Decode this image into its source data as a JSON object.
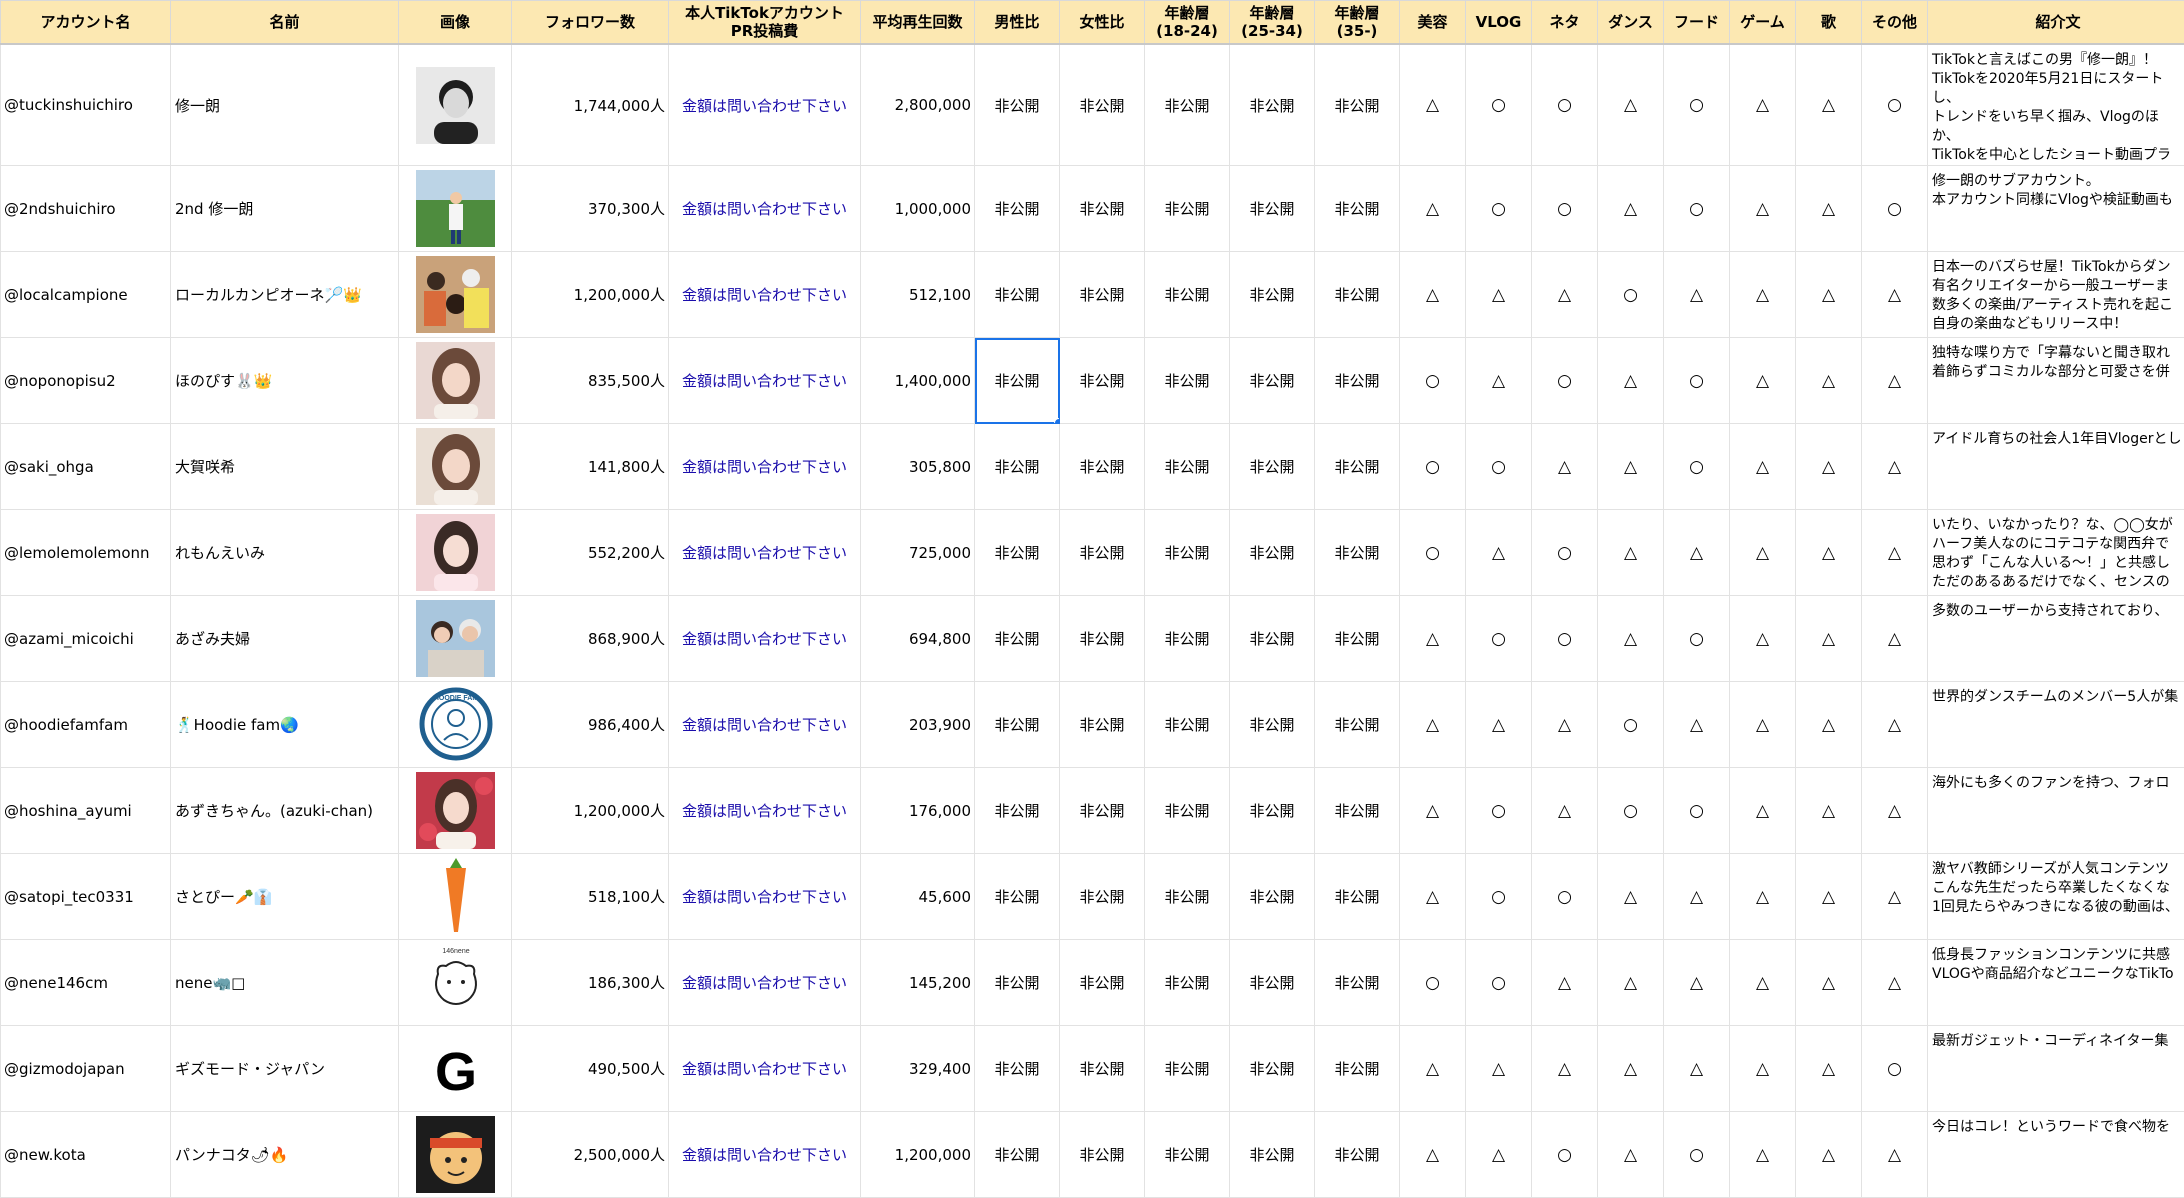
{
  "headers": [
    {
      "l1": "アカウント名"
    },
    {
      "l1": "名前"
    },
    {
      "l1": "画像"
    },
    {
      "l1": "フォロワー数"
    },
    {
      "l1": "本人TikTokアカウント",
      "l2": "PR投稿費"
    },
    {
      "l1": "平均再生回数"
    },
    {
      "l1": "男性比"
    },
    {
      "l1": "女性比"
    },
    {
      "l1": "年齢層",
      "l2": "(18-24)"
    },
    {
      "l1": "年齢層",
      "l2": "(25-34)"
    },
    {
      "l1": "年齢層",
      "l2": "(35-)"
    },
    {
      "l1": "美容"
    },
    {
      "l1": "VLOG"
    },
    {
      "l1": "ネタ"
    },
    {
      "l1": "ダンス"
    },
    {
      "l1": "フード"
    },
    {
      "l1": "ゲーム"
    },
    {
      "l1": "歌"
    },
    {
      "l1": "その他"
    },
    {
      "l1": "紹介文"
    }
  ],
  "rows": [
    {
      "account": "@tuckinshuichiro",
      "name": "修一朗",
      "image": "portrait-bw",
      "followers": "1,744,000人",
      "pr": "金額は問い合わせ下さい",
      "avg_views": "2,800,000",
      "male": "非公開",
      "female": "非公開",
      "age1": "非公開",
      "age2": "非公開",
      "age3": "非公開",
      "tags": [
        "△",
        "○",
        "○",
        "△",
        "○",
        "△",
        "△",
        "○"
      ],
      "intro": "TikTokと言えばこの男『修一朗』！\nTikTokを2020年5月21日にスタートし、\nトレンドをいち早く掴み、Vlogのほか、\nTikTokを中心としたショート動画プラ"
    },
    {
      "account": "@2ndshuichiro",
      "name": "2nd 修一朗",
      "image": "baseball-field",
      "followers": "370,300人",
      "pr": "金額は問い合わせ下さい",
      "avg_views": "1,000,000",
      "male": "非公開",
      "female": "非公開",
      "age1": "非公開",
      "age2": "非公開",
      "age3": "非公開",
      "tags": [
        "△",
        "○",
        "○",
        "△",
        "○",
        "△",
        "△",
        "○"
      ],
      "intro": "修一朗のサブアカウント。\n本アカウント同様にVlogや検証動画も"
    },
    {
      "account": "@localcampione",
      "name": "ローカルカンピオーネ🏸👑",
      "image": "group-photo",
      "followers": "1,200,000人",
      "pr": "金額は問い合わせ下さい",
      "avg_views": "512,100",
      "male": "非公開",
      "female": "非公開",
      "age1": "非公開",
      "age2": "非公開",
      "age3": "非公開",
      "tags": [
        "△",
        "△",
        "△",
        "○",
        "△",
        "△",
        "△",
        "△"
      ],
      "intro": "日本一のバズらせ屋！TikTokからダン\n有名クリエイターから一般ユーザーま\n数多くの楽曲/アーティスト売れを起こ\n自身の楽曲などもリリース中！"
    },
    {
      "account": "@noponopisu2",
      "name": "ほのぴす🐰👑",
      "image": "portrait-girl",
      "followers": "835,500人",
      "pr": "金額は問い合わせ下さい",
      "avg_views": "1,400,000",
      "male": "非公開",
      "female": "非公開",
      "age1": "非公開",
      "age2": "非公開",
      "age3": "非公開",
      "tags": [
        "○",
        "△",
        "○",
        "△",
        "○",
        "△",
        "△",
        "△"
      ],
      "intro": "独特な喋り方で「字幕ないと聞き取れ\n着飾らずコミカルな部分と可愛さを併"
    },
    {
      "account": "@saki_ohga",
      "name": "大賀咲希",
      "image": "portrait-girl2",
      "followers": "141,800人",
      "pr": "金額は問い合わせ下さい",
      "avg_views": "305,800",
      "male": "非公開",
      "female": "非公開",
      "age1": "非公開",
      "age2": "非公開",
      "age3": "非公開",
      "tags": [
        "○",
        "○",
        "△",
        "△",
        "○",
        "△",
        "△",
        "△"
      ],
      "intro": "アイドル育ちの社会人1年目Vlogerとし"
    },
    {
      "account": "@lemolemolemonn",
      "name": "れもんえいみ",
      "image": "portrait-pink",
      "followers": "552,200人",
      "pr": "金額は問い合わせ下さい",
      "avg_views": "725,000",
      "male": "非公開",
      "female": "非公開",
      "age1": "非公開",
      "age2": "非公開",
      "age3": "非公開",
      "tags": [
        "○",
        "△",
        "○",
        "△",
        "△",
        "△",
        "△",
        "△"
      ],
      "intro": "いたり、いなかったり？な、◯◯女が\nハーフ美人なのにコテコテな関西弁で\n思わず「こんな人いる〜！」と共感し\nただのあるあるだけでなく、センスの"
    },
    {
      "account": "@azami_micoichi",
      "name": "あざみ夫婦",
      "image": "couple",
      "followers": "868,900人",
      "pr": "金額は問い合わせ下さい",
      "avg_views": "694,800",
      "male": "非公開",
      "female": "非公開",
      "age1": "非公開",
      "age2": "非公開",
      "age3": "非公開",
      "tags": [
        "△",
        "○",
        "○",
        "△",
        "○",
        "△",
        "△",
        "△"
      ],
      "intro": "多数のユーザーから支持されており、"
    },
    {
      "account": "@hoodiefamfam",
      "name": "🕺Hoodie fam🌏",
      "image": "hoodie-logo",
      "followers": "986,400人",
      "pr": "金額は問い合わせ下さい",
      "avg_views": "203,900",
      "male": "非公開",
      "female": "非公開",
      "age1": "非公開",
      "age2": "非公開",
      "age3": "非公開",
      "tags": [
        "△",
        "△",
        "△",
        "○",
        "△",
        "△",
        "△",
        "△"
      ],
      "intro": "世界的ダンスチームのメンバー5人が集"
    },
    {
      "account": "@hoshina_ayumi",
      "name": "あずきちゃん。(azuki-chan)",
      "image": "portrait-flowers",
      "followers": "1,200,000人",
      "pr": "金額は問い合わせ下さい",
      "avg_views": "176,000",
      "male": "非公開",
      "female": "非公開",
      "age1": "非公開",
      "age2": "非公開",
      "age3": "非公開",
      "tags": [
        "△",
        "○",
        "△",
        "○",
        "○",
        "△",
        "△",
        "△"
      ],
      "intro": "海外にも多くのファンを持つ、フォロ"
    },
    {
      "account": "@satopi_tec0331",
      "name": "さとぴー🥕👔",
      "image": "carrot",
      "followers": "518,100人",
      "pr": "金額は問い合わせ下さい",
      "avg_views": "45,600",
      "male": "非公開",
      "female": "非公開",
      "age1": "非公開",
      "age2": "非公開",
      "age3": "非公開",
      "tags": [
        "△",
        "○",
        "○",
        "△",
        "△",
        "△",
        "△",
        "△"
      ],
      "intro": "激ヤバ教師シリーズが人気コンテンツ\nこんな先生だったら卒業したくなくな\n1回見たらやみつきになる彼の動画は、"
    },
    {
      "account": "@nene146cm",
      "name": "nene🦏□",
      "image": "nene-logo",
      "followers": "186,300人",
      "pr": "金額は問い合わせ下さい",
      "avg_views": "145,200",
      "male": "非公開",
      "female": "非公開",
      "age1": "非公開",
      "age2": "非公開",
      "age3": "非公開",
      "tags": [
        "○",
        "○",
        "△",
        "△",
        "△",
        "△",
        "△",
        "△"
      ],
      "intro": "低身長ファッションコンテンツに共感\nVLOGや商品紹介などユニークなTikTo"
    },
    {
      "account": "@gizmodojapan",
      "name": "ギズモード・ジャパン",
      "image": "g-logo",
      "followers": "490,500人",
      "pr": "金額は問い合わせ下さい",
      "avg_views": "329,400",
      "male": "非公開",
      "female": "非公開",
      "age1": "非公開",
      "age2": "非公開",
      "age3": "非公開",
      "tags": [
        "△",
        "△",
        "△",
        "△",
        "△",
        "△",
        "△",
        "○"
      ],
      "intro": "最新ガジェット・コーディネイター集"
    },
    {
      "account": "@new.kota",
      "name": "パンナコタ🌶🔥",
      "image": "cartoon",
      "followers": "2,500,000人",
      "pr": "金額は問い合わせ下さい",
      "avg_views": "1,200,000",
      "male": "非公開",
      "female": "非公開",
      "age1": "非公開",
      "age2": "非公開",
      "age3": "非公開",
      "tags": [
        "△",
        "△",
        "○",
        "△",
        "○",
        "△",
        "△",
        "△"
      ],
      "intro": "今日はコレ！というワードで食べ物を"
    }
  ],
  "hoodie_logo_text": "HOODIE FAM",
  "nene_logo_text": "146nene",
  "g_logo_text": "G"
}
